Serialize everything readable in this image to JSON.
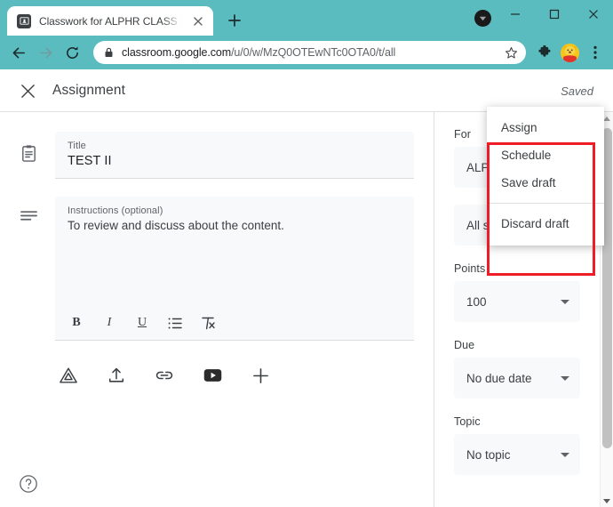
{
  "browser": {
    "theme_color": "#5bbcc0",
    "tab": {
      "title": "Classwork for ALPHR CLASS SAM",
      "favicon_name": "classroom-favicon",
      "close_label": "✕"
    },
    "new_tab_label": "+",
    "window_controls": {
      "minimize": "–",
      "maximize": "☐",
      "close": "✕"
    },
    "nav": {
      "back": "←",
      "forward": "→",
      "reload": "↻"
    },
    "omnibox": {
      "lock_icon": "lock-icon",
      "url_domain": "classroom.google.com",
      "url_path": "/u/0/w/MzQ0OTEwNTc0OTA0/t/all",
      "bookmark_icon": "star-icon"
    },
    "toolbar_icons": {
      "extensions": "puzzle-piece-icon",
      "profile": "profile-avatar",
      "menu": "three-dot-menu-icon"
    }
  },
  "app_header": {
    "close_icon": "close-icon",
    "title": "Assignment",
    "status": "Saved"
  },
  "form": {
    "title_field": {
      "icon": "clipboard-icon",
      "label": "Title",
      "value": "TEST II"
    },
    "instructions_field": {
      "icon": "description-lines-icon",
      "label": "Instructions (optional)",
      "value": "To review and discuss about the content."
    },
    "format_toolbar": [
      {
        "name": "bold-button",
        "glyph": "B"
      },
      {
        "name": "italic-button",
        "glyph": "I"
      },
      {
        "name": "underline-button",
        "glyph": "U"
      },
      {
        "name": "bulleted-list-button",
        "glyph": "list"
      },
      {
        "name": "clear-formatting-button",
        "glyph": "clear"
      }
    ],
    "attachments": [
      {
        "name": "google-drive-button",
        "label": "Drive"
      },
      {
        "name": "upload-button",
        "label": "Upload"
      },
      {
        "name": "link-button",
        "label": "Link"
      },
      {
        "name": "youtube-button",
        "label": "YouTube"
      },
      {
        "name": "create-button",
        "label": "Create"
      }
    ],
    "help_icon": "help-circle-icon"
  },
  "sidebar": {
    "for": {
      "label": "For",
      "class_value": "ALPHR",
      "students_value": "All students"
    },
    "points": {
      "label": "Points",
      "value": "100"
    },
    "due": {
      "label": "Due",
      "value": "No due date"
    },
    "topic": {
      "label": "Topic",
      "value": "No topic"
    }
  },
  "dropdown_menu": {
    "highlight_color": "#ee1c25",
    "items": [
      {
        "label": "Assign"
      },
      {
        "label": "Schedule"
      },
      {
        "label": "Save draft"
      },
      {
        "label": "Discard draft"
      }
    ]
  }
}
